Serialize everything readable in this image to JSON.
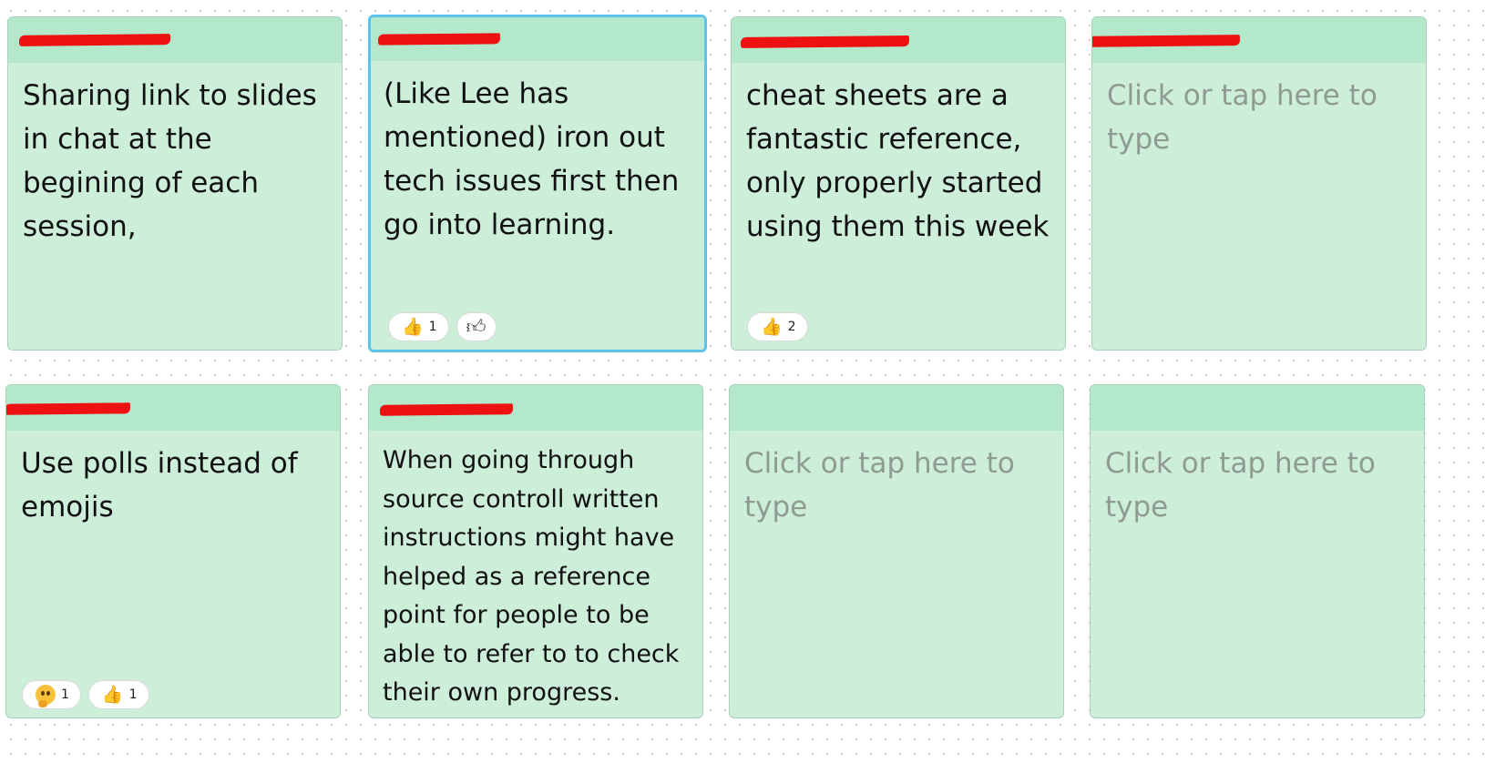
{
  "placeholder": "Click or tap here to type",
  "notes": [
    {
      "text": "Sharing link to slides in chat at the begining of each session,",
      "reactions": []
    },
    {
      "text": "(Like Lee has mentioned) iron out tech issues first then go into learning.",
      "reactions": [
        {
          "emoji": "thumbs-up",
          "count": "1"
        }
      ],
      "add_reaction_icon": "thumbs-up-outline-icon"
    },
    {
      "text": "cheat sheets are a fantastic reference, only properly started using them this week",
      "reactions": [
        {
          "emoji": "thumbs-up",
          "count": "2"
        }
      ]
    },
    {
      "text": "",
      "reactions": []
    },
    {
      "text": "Use polls instead of emojis",
      "reactions": [
        {
          "emoji": "thinking-face",
          "count": "1"
        },
        {
          "emoji": "thumbs-up",
          "count": "1"
        }
      ]
    },
    {
      "text": "When going through source controll written instructions might have helped as a reference point for people to be able to refer to to check their own progress.",
      "reactions": []
    },
    {
      "text": "",
      "reactions": []
    },
    {
      "text": "",
      "reactions": []
    }
  ],
  "colors": {
    "note_body": "#cdeed9",
    "note_header": "#b3e8cb",
    "selected_border": "#5cc4e8",
    "redaction": "#ee1111",
    "placeholder_text": "#8e9a92"
  }
}
